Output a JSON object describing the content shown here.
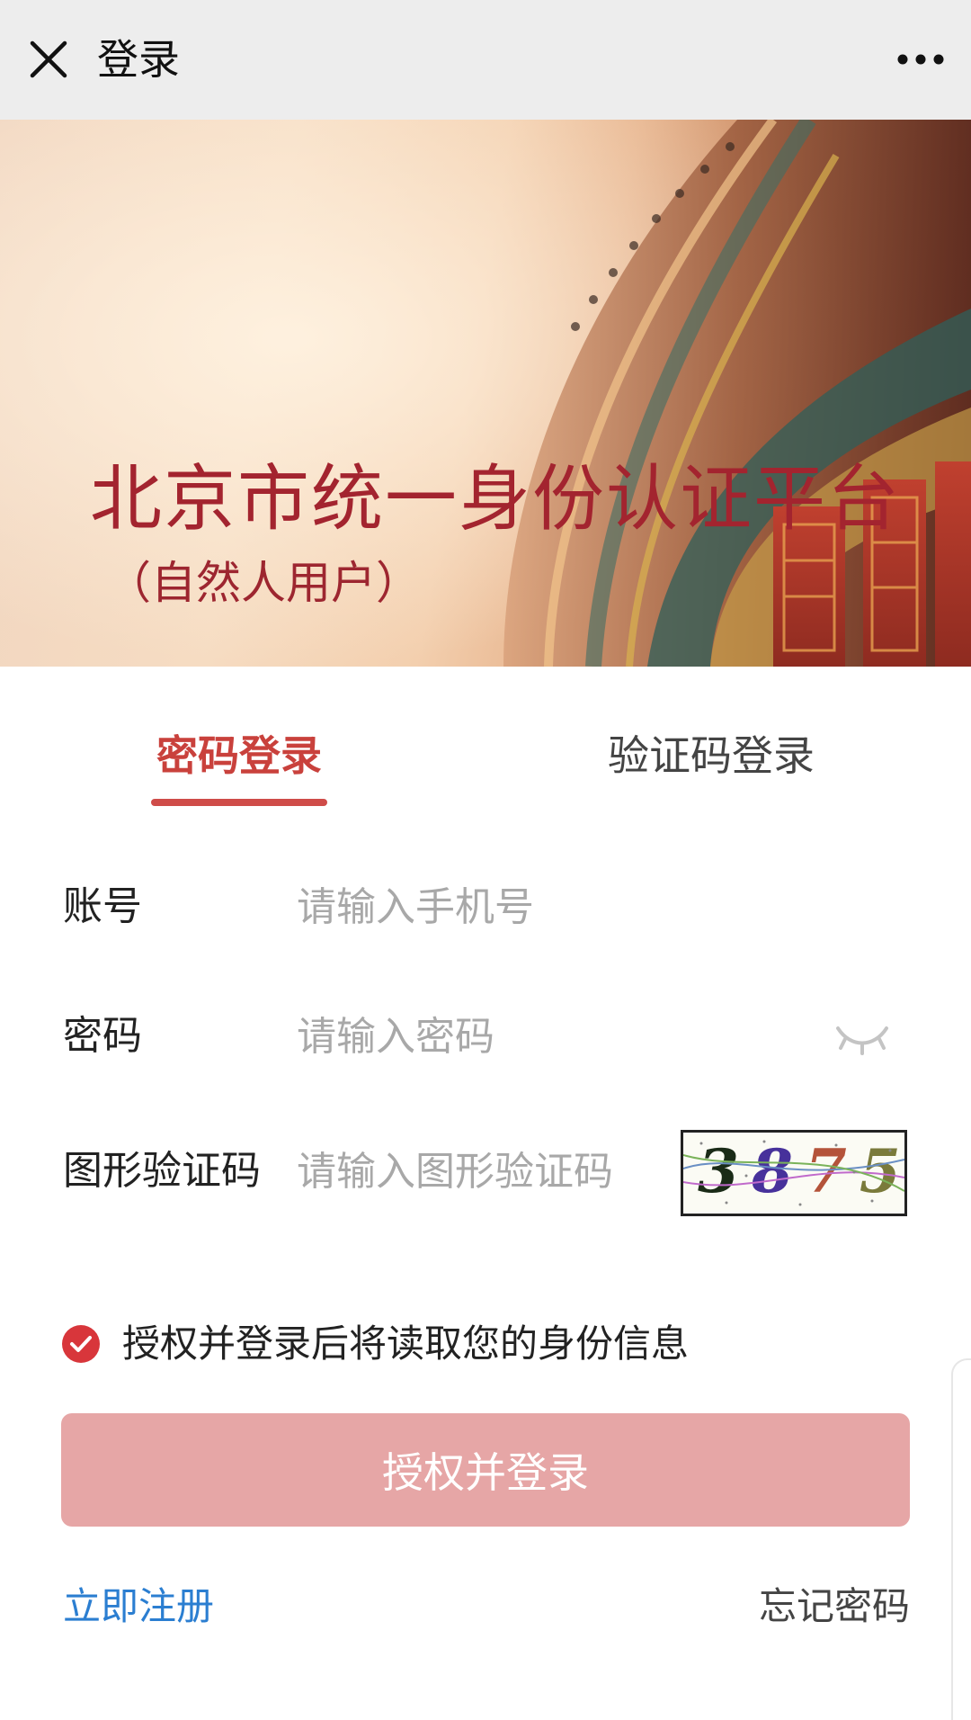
{
  "header": {
    "title": "登录",
    "close_icon": "close-icon",
    "more_icon": "more-dots-icon"
  },
  "banner": {
    "title": "北京市统一身份认证平台",
    "subtitle": "（自然人用户）"
  },
  "tabs": [
    {
      "label": "密码登录",
      "active": true
    },
    {
      "label": "验证码登录",
      "active": false
    }
  ],
  "form": {
    "account": {
      "label": "账号",
      "placeholder": "请输入手机号",
      "value": ""
    },
    "password": {
      "label": "密码",
      "placeholder": "请输入密码",
      "value": "",
      "toggle_icon": "eye-closed-icon"
    },
    "captcha": {
      "label": "图形验证码",
      "placeholder": "请输入图形验证码",
      "value": "",
      "image_text": [
        "3",
        "8",
        "7",
        "5"
      ]
    }
  },
  "consent": {
    "checked": true,
    "text": "授权并登录后将读取您的身份信息"
  },
  "submit": {
    "label": "授权并登录"
  },
  "links": {
    "register": "立即注册",
    "forgot": "忘记密码"
  },
  "colors": {
    "accent": "#c9413c",
    "button_disabled": "#e6a6a6",
    "link": "#2b7ed1",
    "banner_title": "#a3242f"
  }
}
